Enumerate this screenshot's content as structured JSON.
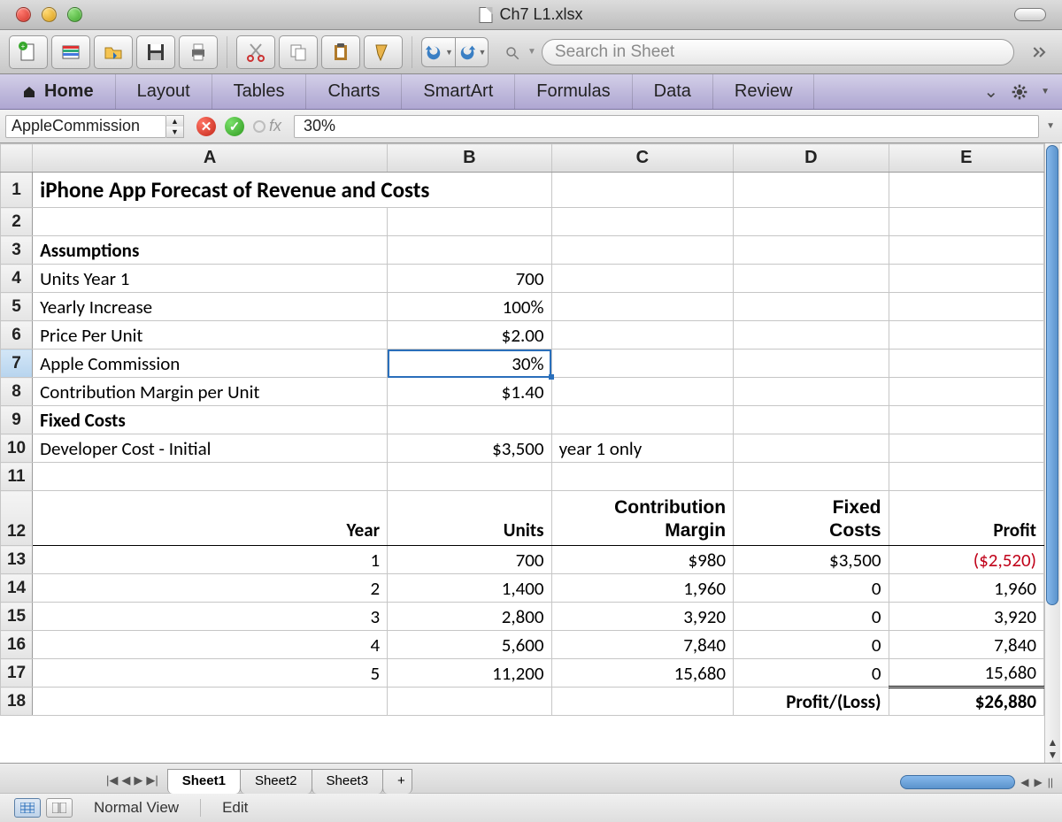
{
  "window": {
    "title": "Ch7 L1.xlsx"
  },
  "search": {
    "placeholder": "Search in Sheet"
  },
  "ribbon": {
    "tabs": [
      "Home",
      "Layout",
      "Tables",
      "Charts",
      "SmartArt",
      "Formulas",
      "Data",
      "Review"
    ]
  },
  "formula_bar": {
    "name_box": "AppleCommission",
    "fx_label": "fx",
    "value": "30%"
  },
  "columns": [
    "A",
    "B",
    "C",
    "D",
    "E"
  ],
  "rows": {
    "r1": {
      "A": "iPhone App Forecast of Revenue and Costs"
    },
    "r2": {},
    "r3": {
      "A": "Assumptions"
    },
    "r4": {
      "A": "Units Year 1",
      "B": "700"
    },
    "r5": {
      "A": "Yearly Increase",
      "B": "100%"
    },
    "r6": {
      "A": "Price Per Unit",
      "B": "$2.00"
    },
    "r7": {
      "A": "Apple Commission",
      "B": "30%"
    },
    "r8": {
      "A": "Contribution Margin per Unit",
      "B": "$1.40"
    },
    "r9": {
      "A": "Fixed  Costs"
    },
    "r10": {
      "A": "Developer Cost - Initial",
      "B": "$3,500",
      "C": "year 1 only"
    },
    "r11": {},
    "r12": {
      "A": "Year",
      "B": "Units",
      "C_top": "Contribution",
      "C": "Margin",
      "D_top": "Fixed",
      "D": "Costs",
      "E": "Profit"
    },
    "r13": {
      "A": "1",
      "B": "700",
      "C": "$980",
      "D": "$3,500",
      "E": "($2,520)"
    },
    "r14": {
      "A": "2",
      "B": "1,400",
      "C": "1,960",
      "D": "0",
      "E": "1,960"
    },
    "r15": {
      "A": "3",
      "B": "2,800",
      "C": "3,920",
      "D": "0",
      "E": "3,920"
    },
    "r16": {
      "A": "4",
      "B": "5,600",
      "C": "7,840",
      "D": "0",
      "E": "7,840"
    },
    "r17": {
      "A": "5",
      "B": "11,200",
      "C": "15,680",
      "D": "0",
      "E": "15,680"
    },
    "r18": {
      "D": "Profit/(Loss)",
      "E": "$26,880"
    }
  },
  "sheet_tabs": [
    "Sheet1",
    "Sheet2",
    "Sheet3"
  ],
  "status": {
    "view": "Normal View",
    "mode": "Edit"
  }
}
